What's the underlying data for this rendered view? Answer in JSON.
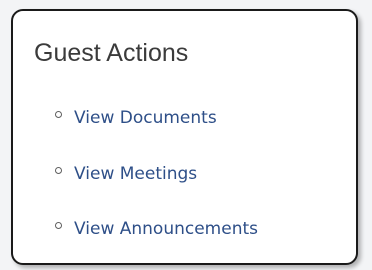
{
  "panel": {
    "title": "Guest Actions",
    "items": [
      {
        "label": "View Documents"
      },
      {
        "label": "View Meetings"
      },
      {
        "label": "View Announcements"
      }
    ]
  },
  "colors": {
    "title": "#3b3b3b",
    "link": "#2e4f88",
    "border": "#1a1a1a",
    "background": "#ffffff"
  },
  "icons": {
    "bullet": "bullet-circle-icon"
  }
}
